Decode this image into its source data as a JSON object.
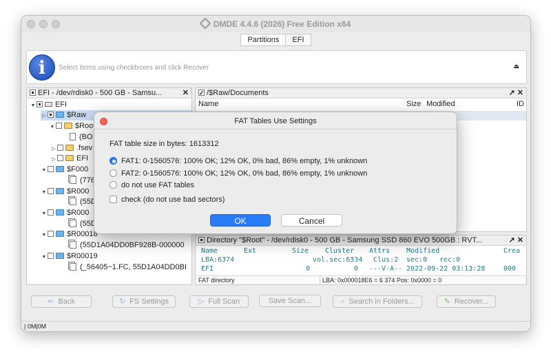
{
  "window": {
    "title": "DMDE 4.4.6 (2026) Free Edition x64"
  },
  "tabs": [
    {
      "label": "Partitions"
    },
    {
      "label": "EFI"
    }
  ],
  "infobar": {
    "text": "Select items using checkboxes and click Recover",
    "eject_glyph": "⏏",
    "info_glyph": "i"
  },
  "left_panel": {
    "header": "EFI - /dev/rdisk0 - 500 GB - Samsu...",
    "close_glyph": "✕",
    "tree": [
      {
        "label": "EFI"
      },
      {
        "label": "$Raw"
      },
      {
        "label": "$Root"
      },
      {
        "label": "(BO"
      },
      {
        "label": ".fsev"
      },
      {
        "label": "EFI"
      },
      {
        "label": "$F000"
      },
      {
        "label": "(776"
      },
      {
        "label": "$R000"
      },
      {
        "label": "(55D"
      },
      {
        "label": "$R000"
      },
      {
        "label": "(55D"
      },
      {
        "label": "$R00018"
      },
      {
        "label": "(55D1A04DD0BF928B-000000"
      },
      {
        "label": "$R00019"
      },
      {
        "label": "(_56405~1.FC, 55D1A04DD0BI"
      }
    ]
  },
  "right_panel": {
    "header": "/$Raw/Documents",
    "header_btns": "↗ ✕",
    "columns": {
      "name": "Name",
      "size": "Size",
      "modified": "Modified",
      "id": "ID"
    }
  },
  "dir_panel": {
    "header": "Directory \"$Root\" - /dev/rdisk0 - 500 GB - Samsung SSD 860 EVO 500GB : RVT...",
    "header_btns": "↗ ✕",
    "cols": {
      "name": "Name",
      "ext": "Ext",
      "size": "Size",
      "cluster": "Cluster",
      "attrs": "Attrs",
      "modified": "Modified",
      "crea": "Crea"
    },
    "row1": {
      "name": "LBA:6374",
      "sec": "vol.sec:6334",
      "clus": "Clus:2",
      "sec0": "sec:0",
      "rec0": "rec:0"
    },
    "row2": {
      "name": "EFI",
      "size": "0",
      "cluster": "0",
      "attrs": "---V-A--",
      "modified": "2022-09-22 03:13:28",
      "crea": "000"
    },
    "status_left": "FAT directory",
    "status_right": "LBA: 0x000018E6 = 6 374  Pos: 0x0000 = 0"
  },
  "buttons": {
    "back": "Back",
    "fs_settings": "FS Settings",
    "full_scan": "Full Scan",
    "save_scan": "Save Scan...",
    "search": "Search in Folders...",
    "recover": "Recover..."
  },
  "statusbar": {
    "text": "| 0M|0M"
  },
  "dialog": {
    "title": "FAT Tables Use Settings",
    "size_text": "FAT table size in bytes: 1613312",
    "options": [
      {
        "label": "FAT1: 0-1560576: 100% OK; 12% OK, 0% bad, 86% empty, 1% unknown",
        "selected": true
      },
      {
        "label": "FAT2: 0-1560576: 100% OK; 12% OK, 0% bad, 86% empty, 1% unknown",
        "selected": false
      },
      {
        "label": "do not use FAT tables",
        "selected": false
      }
    ],
    "check_label": "check (do not use bad sectors)",
    "ok": "OK",
    "cancel": "Cancel"
  },
  "colors": {
    "accent": "#2a7cf6",
    "dir_text": "#1f7b88",
    "selection": "#c9dcf3"
  }
}
